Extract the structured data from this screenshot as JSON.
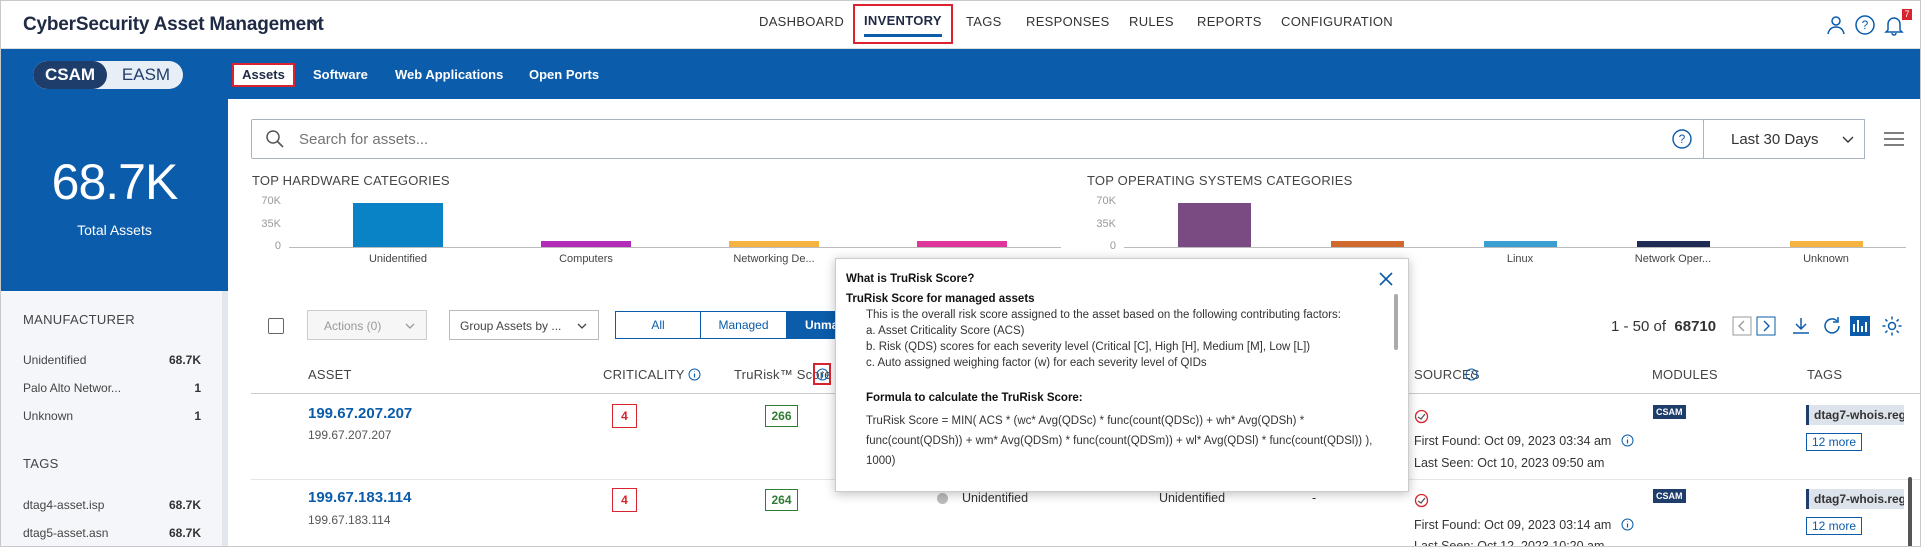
{
  "app": {
    "title": "CyberSecurity Asset Management"
  },
  "topnav": [
    {
      "label": "DASHBOARD"
    },
    {
      "label": "INVENTORY"
    },
    {
      "label": "TAGS"
    },
    {
      "label": "RESPONSES"
    },
    {
      "label": "RULES"
    },
    {
      "label": "REPORTS"
    },
    {
      "label": "CONFIGURATION"
    }
  ],
  "notifications": {
    "count": "7"
  },
  "mode_toggle": {
    "active": "CSAM",
    "inactive": "EASM"
  },
  "subtabs": [
    {
      "label": "Assets"
    },
    {
      "label": "Software"
    },
    {
      "label": "Web Applications"
    },
    {
      "label": "Open Ports"
    }
  ],
  "summary": {
    "total": "68.7K",
    "total_label": "Total Assets"
  },
  "search": {
    "placeholder": "Search for assets...",
    "date_range": "Last 30 Days"
  },
  "left_panel": {
    "manufacturer_title": "MANUFACTURER",
    "manufacturers": [
      {
        "name": "Unidentified",
        "count": "68.7K"
      },
      {
        "name": "Palo Alto Networ...",
        "count": "1"
      },
      {
        "name": "Unknown",
        "count": "1"
      }
    ],
    "tags_title": "TAGS",
    "tags": [
      {
        "name": "dtag4-asset.isp",
        "count": "68.7K"
      },
      {
        "name": "dtag5-asset.asn",
        "count": "68.7K"
      }
    ]
  },
  "chart_data": [
    {
      "type": "bar",
      "title": "TOP HARDWARE CATEGORIES",
      "yticks": [
        "70K",
        "35K",
        "0"
      ],
      "ylim": [
        0,
        70000
      ],
      "categories": [
        "Unidentified",
        "Computers",
        "Networking De..."
      ],
      "values": [
        68700,
        9000,
        9000
      ],
      "colors": [
        "#0a83c6",
        "#b32ab8",
        "#f5b342"
      ],
      "hidden_bar": {
        "value": 9000,
        "color": "#e0359a"
      }
    },
    {
      "type": "bar",
      "title": "TOP OPERATING SYSTEMS CATEGORIES",
      "yticks": [
        "70K",
        "35K",
        "0"
      ],
      "ylim": [
        0,
        70000
      ],
      "categories": [
        "",
        "",
        "Linux",
        "Network Oper...",
        "Unknown"
      ],
      "values": [
        68700,
        9000,
        9000,
        9000,
        9000
      ],
      "colors": [
        "#7a4b82",
        "#d0692b",
        "#3a9fd0",
        "#1f2a55",
        "#f5b342"
      ]
    }
  ],
  "toolbar": {
    "actions_label": "Actions (0)",
    "group_by": "Group Assets by ...",
    "segments": [
      "All",
      "Managed",
      "Unma"
    ],
    "pager_range": "1 - 50 of",
    "pager_total": "68710"
  },
  "table": {
    "headers": {
      "asset": "ASSET",
      "criticality": "CRITICALITY",
      "trurisk": "TruRisk™ Score",
      "sources": "SOURCES",
      "modules": "MODULES",
      "tags": "TAGS"
    },
    "rows": [
      {
        "ip": "199.67.207.207",
        "ip_sub": "199.67.207.207",
        "criticality": "4",
        "score": "266",
        "first_found": "First Found: Oct 09, 2023 03:34 am",
        "last_seen": "Last Seen: Oct 10, 2023 09:50 am",
        "module": "CSAM",
        "tag": "dtag7-whois.reg",
        "more": "12 more"
      },
      {
        "ip": "199.67.183.114",
        "ip_sub": "199.67.183.114",
        "criticality": "4",
        "score": "264",
        "category": "Unidentified",
        "os": "Unidentified",
        "dash": "-",
        "first_found": "First Found: Oct 09, 2023 03:14 am",
        "last_seen": "Last Seen: Oct 12, 2023 10:20 am",
        "module": "CSAM",
        "tag": "dtag7-whois.reg",
        "more": "12 more"
      }
    ]
  },
  "popup": {
    "title": "What is TruRisk Score?",
    "subtitle": "TruRisk Score for managed assets",
    "intro": "This is the overall risk score assigned to the asset based on the following contributing factors:",
    "factors": [
      "a. Asset Criticality Score (ACS)",
      "b. Risk (QDS) scores for each severity level (Critical [C], High [H], Medium [M], Low [L])",
      "c. Auto assigned weighing factor (w) for each severity level of QIDs"
    ],
    "formula_title": "Formula to calculate the TruRisk Score:",
    "formula_1": "TruRisk Score = MIN( ACS * (w",
    "formula_line1": "TruRisk Score = MIN( ACS * (wc* Avg(QDSc) * func(count(QDSc)) + wh* Avg(QDSh) *",
    "formula_line2": "func(count(QDSh)) + wm* Avg(QDSm) * func(count(QDSm)) + wl* Avg(QDSl) * func(count(QDSl)) ),",
    "formula_line3": "1000)"
  }
}
